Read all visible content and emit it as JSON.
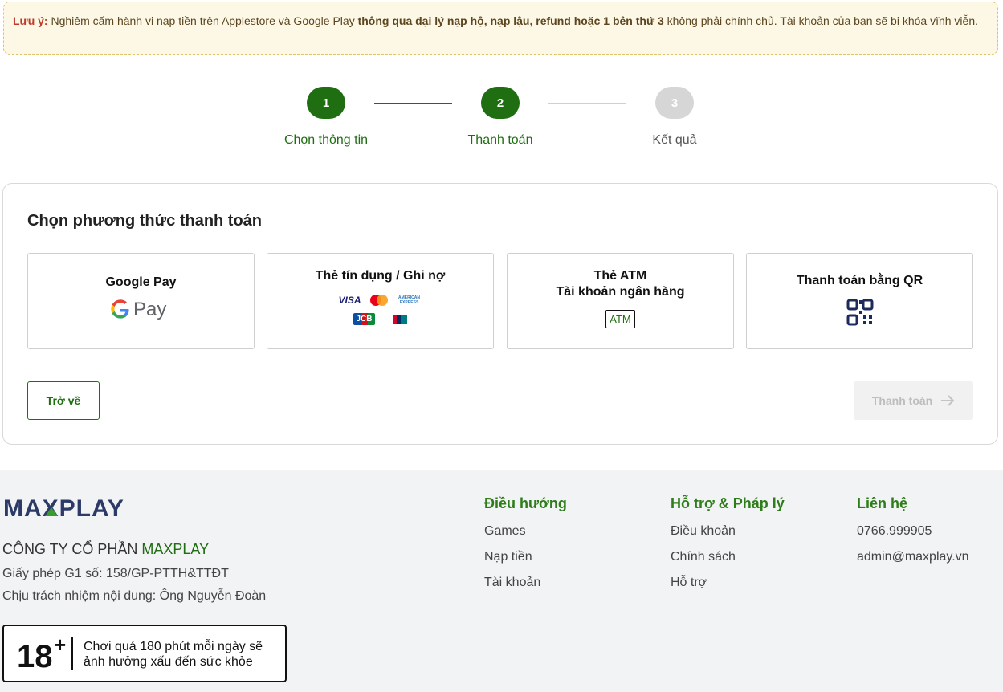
{
  "notice": {
    "label": "Lưu ý:",
    "text1": " Nghiêm cấm hành vi nạp tiền trên Applestore và Google Play ",
    "bold": "thông qua đại lý nạp hộ, nạp lậu, refund hoặc 1 bên thứ 3",
    "text2": " không phải chính chủ. Tài khoản của bạn sẽ bị khóa vĩnh viễn."
  },
  "steps": [
    {
      "number": "1",
      "label": "Chọn thông tin",
      "state": "active"
    },
    {
      "number": "2",
      "label": "Thanh toán",
      "state": "active"
    },
    {
      "number": "3",
      "label": "Kết quả",
      "state": "inactive"
    }
  ],
  "payment": {
    "title": "Chọn phương thức thanh toán",
    "methods": [
      {
        "name": "Google Pay",
        "icon": "google-pay-logo"
      },
      {
        "name": "Thẻ tín dụng / Ghi nợ",
        "icon": "card-brands",
        "brands": [
          "VISA",
          "AMERICAN EXPRESS",
          "JCB"
        ]
      },
      {
        "name_line1": "Thẻ ATM",
        "name_line2": "Tài khoản ngân hàng",
        "badge": "ATM"
      },
      {
        "name": "Thanh toán bằng QR",
        "icon": "qr-code-icon"
      }
    ],
    "back_label": "Trở về",
    "pay_label": "Thanh toán"
  },
  "footer": {
    "logo": "MAXPLAY",
    "company_prefix": "CÔNG TY CỔ PHẦN ",
    "company_brand": "MAXPLAY",
    "license": "Giấy phép G1 số: 158/GP-PTTH&TTĐT",
    "responsible": "Chịu trách nhiệm nội dung: Ông Nguyễn Đoàn",
    "age": {
      "number": "18",
      "plus": "+",
      "line1": "Chơi quá 180 phút mỗi ngày sẽ",
      "line2": "ảnh hưởng xấu đến sức khỏe"
    },
    "columns": [
      {
        "title": "Điều hướng",
        "items": [
          "Games",
          "Nạp tiền",
          "Tài khoản"
        ]
      },
      {
        "title": "Hỗ trợ & Pháp lý",
        "items": [
          "Điều khoản",
          "Chính sách",
          "Hỗ trợ"
        ]
      },
      {
        "title": "Liên hệ",
        "items": [
          "0766.999905",
          "admin@maxplay.vn"
        ]
      }
    ]
  },
  "colors": {
    "primary": "#1f6e12",
    "accent_green": "#2e7d1a",
    "logo_navy": "#2b3a67"
  }
}
